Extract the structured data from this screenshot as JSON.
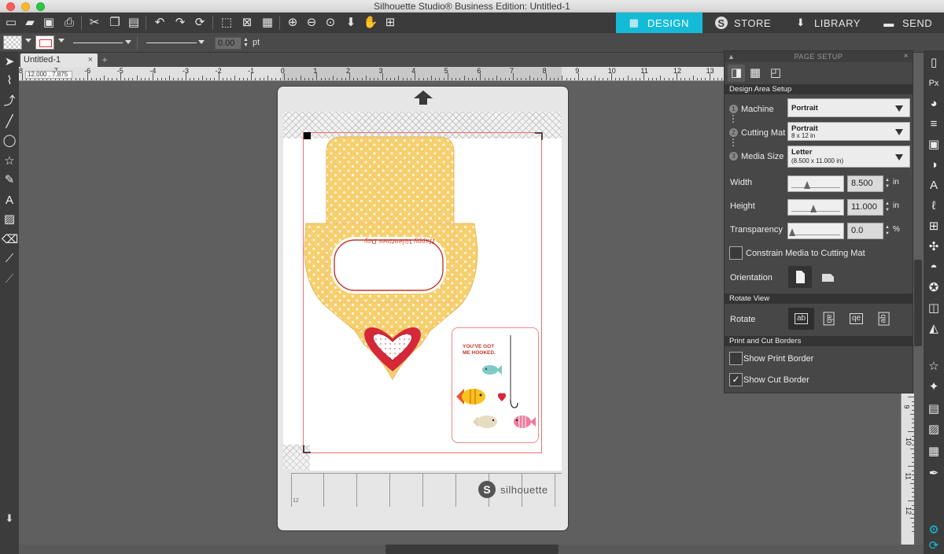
{
  "window": {
    "title": "Silhouette Studio® Business Edition: Untitled-1"
  },
  "nav": {
    "design": "DESIGN",
    "store": "STORE",
    "library": "LIBRARY",
    "send": "SEND"
  },
  "toolbar2": {
    "line_width": "0.00",
    "line_unit": "pt"
  },
  "document": {
    "tab_label": "Untitled-1",
    "coords": "12.000 , 7.875"
  },
  "ruler": {
    "labels": [
      "8",
      "-7",
      "-6",
      "-5",
      "-4",
      "-3",
      "-2",
      "-1",
      "0",
      "1",
      "2",
      "3",
      "4",
      "5",
      "6",
      "7",
      "8",
      "9",
      "10",
      "11",
      "12",
      "13"
    ]
  },
  "vruler": {
    "labels": [
      "9",
      "10",
      "11",
      "12"
    ]
  },
  "mat": {
    "brand": "silhouette",
    "corner_num": "12",
    "card_text": "YOU'VE GOT ME HOOKED.",
    "envelope_text": "Happy Valentines Day"
  },
  "panel": {
    "title": "PAGE SETUP",
    "section_design_area": "Design Area Setup",
    "machine_label": "Machine",
    "machine_value": "Portrait",
    "cutting_mat_label": "Cutting Mat",
    "cutting_mat_value": "Portrait",
    "cutting_mat_sub": "8 x 12 in",
    "media_size_label": "Media Size",
    "media_size_value": "Letter",
    "media_size_sub": "(8.500 x 11.000 in)",
    "width_label": "Width",
    "width_value": "8.500",
    "width_unit": "in",
    "height_label": "Height",
    "height_value": "11.000",
    "height_unit": "in",
    "transparency_label": "Transparency",
    "transparency_value": "0.0",
    "transparency_unit": "%",
    "constrain_label": "Constrain Media to Cutting Mat",
    "orientation_label": "Orientation",
    "section_rotate_view": "Rotate View",
    "rotate_label": "Rotate",
    "rotate_options": [
      "ab",
      "ab",
      "qe",
      "ab"
    ],
    "section_print_cut": "Print and Cut Borders",
    "show_print_border": "Show Print Border",
    "show_cut_border": "Show Cut Border"
  },
  "colors": {
    "accent": "#14bbd7",
    "cut_line": "#e57373",
    "envelope": "#f6cf6e",
    "heart": "#d62839"
  }
}
